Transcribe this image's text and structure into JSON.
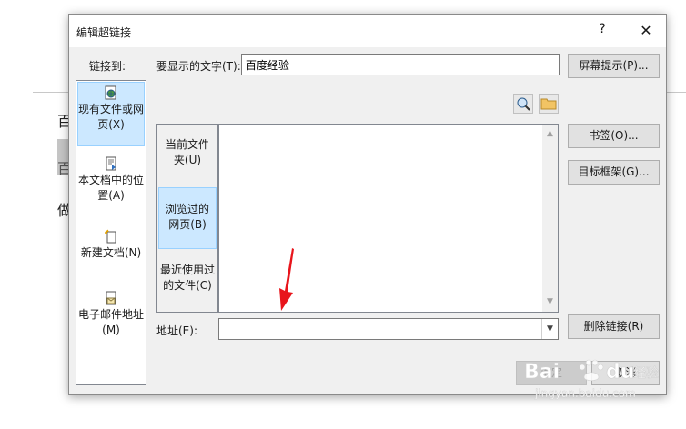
{
  "background_doc": {
    "chars": [
      "百",
      "百",
      "做"
    ]
  },
  "dialog": {
    "title": "编辑超链接",
    "help_label": "?",
    "close_label": "✕",
    "link_to_label": "链接到:",
    "display_text_label": "要显示的文字(T):",
    "display_text_value": "百度经验",
    "screentip_label": "屏幕提示(P)...",
    "link_to_items": [
      {
        "line1": "现有文件或网",
        "line2": "页(X)",
        "icon": "globe-file-icon",
        "selected": true
      },
      {
        "line1": "本文档中的位",
        "line2": "置(A)",
        "icon": "document-place-icon",
        "selected": false
      },
      {
        "line1": "新建文档(N)",
        "line2": "",
        "icon": "new-document-icon",
        "selected": false
      },
      {
        "line1": "电子邮件地址",
        "line2": "(M)",
        "icon": "email-icon",
        "selected": false
      }
    ],
    "look_in_items": [
      {
        "line1": "当前文件",
        "line2": "夹(U)",
        "selected": false
      },
      {
        "line1": "浏览过的",
        "line2": "网页(B)",
        "selected": true
      },
      {
        "line1": "最近使用过",
        "line2": "的文件(C)",
        "selected": false
      }
    ],
    "browse_web_icon": "browse-web-icon",
    "browse_file_icon": "folder-icon",
    "bookmark_label": "书签(O)...",
    "target_frame_label": "目标框架(G)...",
    "address_label": "地址(E):",
    "address_value": "",
    "remove_link_label": "删除链接(R)",
    "ok_label": "确定",
    "cancel_label": "取消"
  },
  "watermark": {
    "brand": "Baidu经验",
    "url": "jingyan.baidu.com"
  },
  "colors": {
    "selection_bg": "#cce8ff",
    "annotation_arrow": "#e8141b"
  }
}
